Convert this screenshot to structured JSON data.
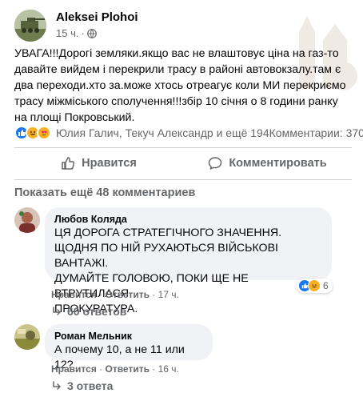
{
  "post": {
    "author": "Aleksei Plohoi",
    "time": "15 ч.",
    "dot": "·",
    "text": "УВАГА!!!Дорогі земляки.якщо вас не влаштовує ціна на газ-то давайте вийдем і перекрили трасу в районі автовокзалу.там є два переходи.хто за.може хтось отреагує коли МИ перекриємо трасу міжміського сполучення!!!збір 10 січня о 8 години ранку на площі Покровський."
  },
  "reactions": {
    "names": "Юлия Галич, Текуч Александр и ещё 194",
    "comments_count": "Комментарии: 370",
    "icons": [
      "like-icon",
      "haha-icon",
      "love-icon"
    ]
  },
  "actions": {
    "like_label": "Нравится",
    "comment_label": "Комментировать"
  },
  "show_more_label": "Показать ещё 48 комментариев",
  "comments": [
    {
      "author": "Любов Коляда",
      "text": "ЦЯ ДОРОГА СТРАТЕГІЧНОГО ЗНАЧЕННЯ.\nЩОДНЯ ПО НІЙ РУХАЮТЬСЯ ВІЙСЬКОВІ ВАНТАЖІ.\nДУМАЙТЕ ГОЛОВОЮ, ПОКИ ЩЕ НЕ ВТРУТИЛАСЯ\nПРОКУРАТУРА.",
      "like_label": "Нравится",
      "reply_label": "Ответить",
      "time": "17 ч.",
      "reaction_count": "6",
      "replies_label": "60 ответов"
    },
    {
      "author": "Роман Мельник",
      "text": "А почему 10, а не 11 или 12?",
      "like_label": "Нравится",
      "reply_label": "Ответить",
      "time": "16 ч.",
      "replies_label": "3 ответа"
    }
  ],
  "colors": {
    "text": "#050505",
    "secondary": "#65676b",
    "bubble": "#f0f2f5",
    "like_blue": "#1877f2",
    "emoji_yellow": "#f7b125"
  }
}
